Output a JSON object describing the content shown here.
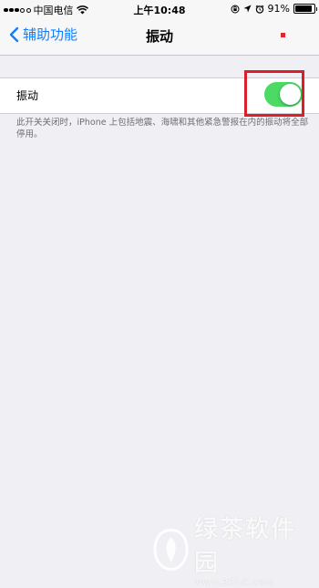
{
  "status_bar": {
    "carrier": "中国电信",
    "time": "上午10:48",
    "battery": "91%",
    "battery_level": 0.91,
    "icons": [
      "signal-dots-icon",
      "wifi-icon",
      "lock-rotation-icon",
      "location-icon",
      "alarm-icon",
      "battery-icon"
    ]
  },
  "nav": {
    "back_label": "辅助功能",
    "title": "振动"
  },
  "setting": {
    "label": "振动",
    "toggle_on": true,
    "toggle_color": "#4cd964"
  },
  "footnote": "此开关关闭时，iPhone 上包括地震、海啸和其他紧急警报在内的振动将全部停用。",
  "accent_color": "#157efb",
  "highlight_color": "#d9202a",
  "watermark": {
    "title": "绿茶软件园",
    "url": "www.33LC.com"
  }
}
